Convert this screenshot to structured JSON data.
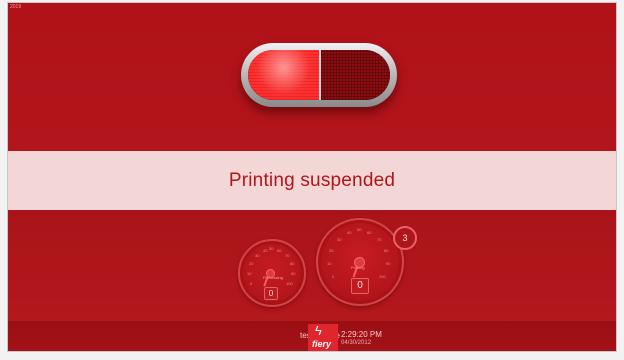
{
  "corner": {
    "label": "2019"
  },
  "status": {
    "message": "Printing suspended"
  },
  "gauges": {
    "small": {
      "label": "Processing",
      "count": "0",
      "ticks": [
        "0",
        "10",
        "20",
        "30",
        "40",
        "50",
        "60",
        "70",
        "80",
        "90",
        "100"
      ]
    },
    "large": {
      "label": "Printing",
      "count": "0",
      "badge": "3",
      "ticks": [
        "0",
        "10",
        "20",
        "30",
        "40",
        "50",
        "60",
        "70",
        "80",
        "90",
        "100"
      ]
    }
  },
  "footer": {
    "server_name": "test-freddie",
    "logo_text": "fiery",
    "time": "2:29:20 PM",
    "date": "04/30/2012"
  },
  "colors": {
    "background": "#b0151b",
    "band": "#f3d7d7",
    "lamp_active": "#ff2d2d",
    "lamp_inactive": "#8c0c10",
    "brand_red": "#e0262d"
  }
}
